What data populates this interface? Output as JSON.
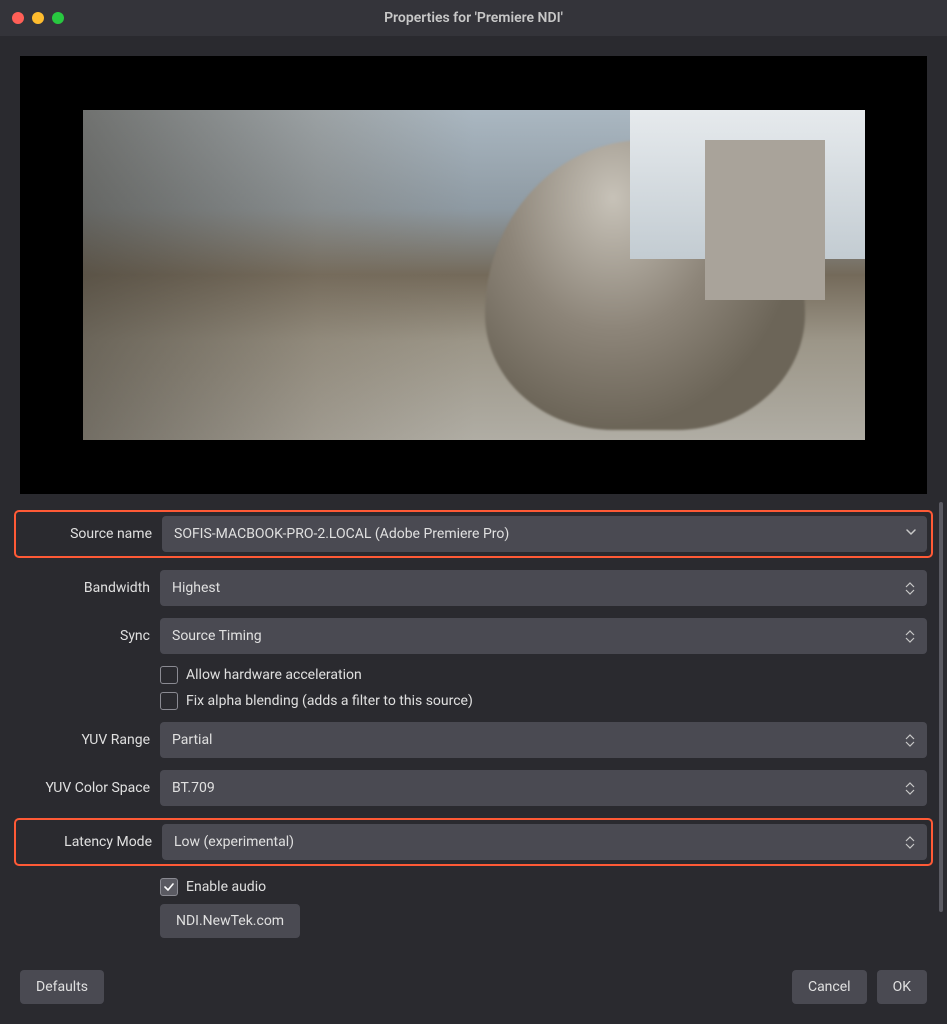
{
  "title": "Properties for 'Premiere NDI'",
  "form": {
    "source_name": {
      "label": "Source name",
      "value": "SOFIS-MACBOOK-PRO-2.LOCAL (Adobe Premiere Pro)"
    },
    "bandwidth": {
      "label": "Bandwidth",
      "value": "Highest"
    },
    "sync": {
      "label": "Sync",
      "value": "Source Timing"
    },
    "allow_hw_accel": {
      "label": "Allow hardware acceleration",
      "checked": false
    },
    "fix_alpha": {
      "label": "Fix alpha blending (adds a filter to this source)",
      "checked": false
    },
    "yuv_range": {
      "label": "YUV Range",
      "value": "Partial"
    },
    "yuv_color_space": {
      "label": "YUV Color Space",
      "value": "BT.709"
    },
    "latency_mode": {
      "label": "Latency Mode",
      "value": "Low (experimental)"
    },
    "enable_audio": {
      "label": "Enable audio",
      "checked": true
    },
    "link_button": "NDI.NewTek.com"
  },
  "buttons": {
    "defaults": "Defaults",
    "cancel": "Cancel",
    "ok": "OK"
  }
}
